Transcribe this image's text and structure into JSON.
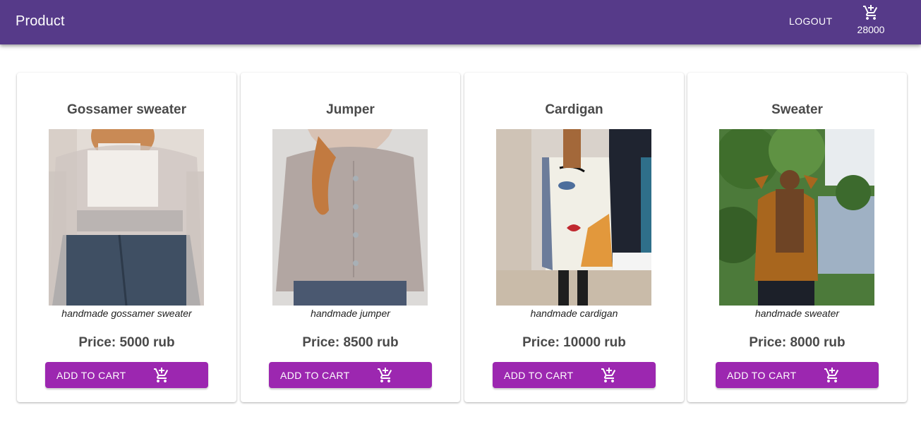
{
  "app": {
    "title": "Product",
    "logout_label": "LOGOUT",
    "cart_icon": "add-shopping-cart-icon",
    "cart_total": "28000",
    "brand_color": "#563a89",
    "button_color": "#9c27b0"
  },
  "products": [
    {
      "name": "Gossamer sweater",
      "description": "handmade gossamer sweater",
      "price": "Price: 5000 rub",
      "button_label": "ADD TO CART",
      "button_icon": "add-shopping-cart-icon"
    },
    {
      "name": "Jumper",
      "description": "handmade jumper",
      "price": "Price: 8500 rub",
      "button_label": "ADD TO CART",
      "button_icon": "add-shopping-cart-icon"
    },
    {
      "name": "Cardigan",
      "description": "handmade cardigan",
      "price": "Price: 10000 rub",
      "button_label": "ADD TO CART",
      "button_icon": "add-shopping-cart-icon"
    },
    {
      "name": "Sweater",
      "description": "handmade sweater",
      "price": "Price: 8000 rub",
      "button_label": "ADD TO CART",
      "button_icon": "add-shopping-cart-icon"
    }
  ]
}
